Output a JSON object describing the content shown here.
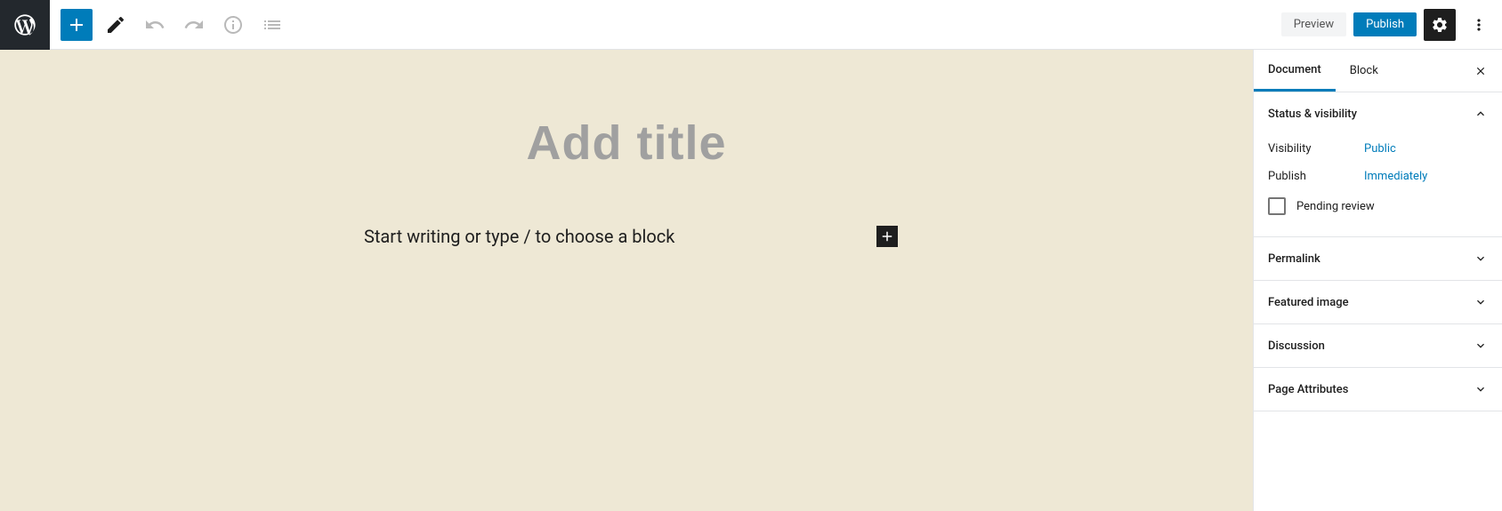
{
  "toolbar": {
    "preview_label": "Preview",
    "publish_label": "Publish"
  },
  "editor": {
    "title_placeholder": "Add title",
    "block_prompt": "Start writing or type / to choose a block"
  },
  "sidebar": {
    "tabs": {
      "document": "Document",
      "block": "Block"
    },
    "panels": {
      "status": {
        "title": "Status & visibility",
        "visibility_label": "Visibility",
        "visibility_value": "Public",
        "publish_label": "Publish",
        "publish_value": "Immediately",
        "pending_review": "Pending review"
      },
      "permalink": "Permalink",
      "featured_image": "Featured image",
      "discussion": "Discussion",
      "page_attributes": "Page Attributes"
    }
  }
}
